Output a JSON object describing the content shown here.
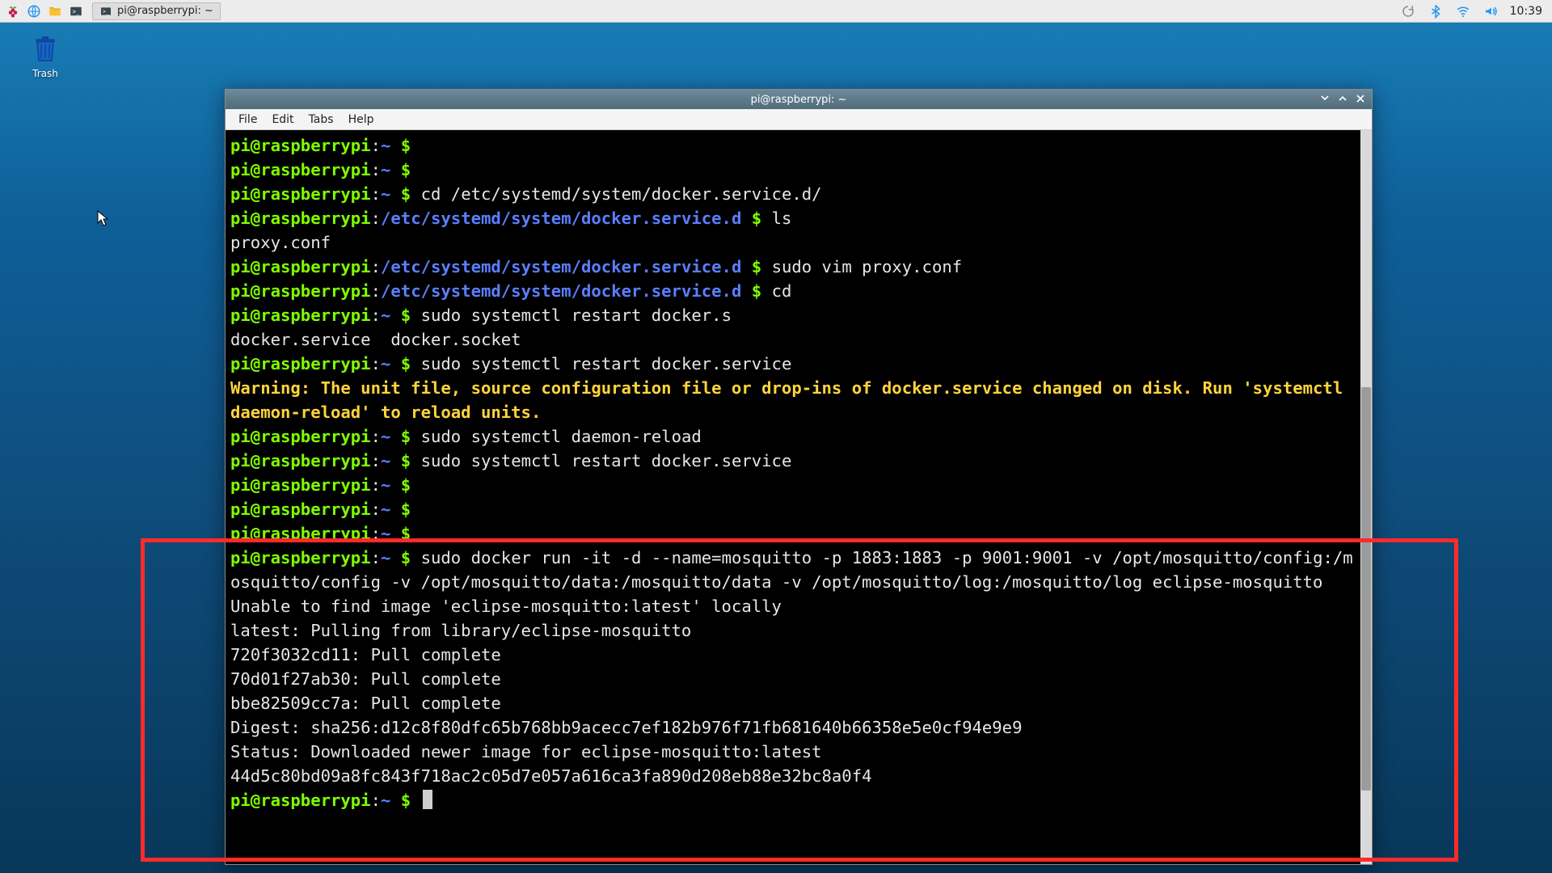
{
  "taskbar": {
    "task_label": "pi@raspberrypi: ~",
    "clock": "10:39"
  },
  "desktop": {
    "trash_label": "Trash"
  },
  "window": {
    "title": "pi@raspberrypi: ~",
    "menu": {
      "file": "File",
      "edit": "Edit",
      "tabs": "Tabs",
      "help": "Help"
    }
  },
  "term": {
    "prompt_user": "pi@raspberrypi",
    "path_home": "~",
    "path_docker": "/etc/systemd/system/docker.service.d",
    "dollar": " $ ",
    "lines": {
      "cd_docker": "cd /etc/systemd/system/docker.service.d/",
      "ls": "ls",
      "out_proxy": "proxy.conf",
      "vim": "sudo vim proxy.conf",
      "cd": "cd",
      "restart_partial": "sudo systemctl restart docker.s",
      "out_services": "docker.service  docker.socket",
      "restart_full": "sudo systemctl restart docker.service",
      "warning": "Warning: The unit file, source configuration file or drop-ins of docker.service changed on disk. Run 'systemctl daemon-reload' to reload units.",
      "daemon_reload": "sudo systemctl daemon-reload",
      "docker_run": "sudo docker run -it -d --name=mosquitto -p 1883:1883 -p 9001:9001 -v /opt/mosquitto/config:/mosquitto/config -v /opt/mosquitto/data:/mosquitto/data -v /opt/mosquitto/log:/mosquitto/log eclipse-mosquitto",
      "out_notfound": "Unable to find image 'eclipse-mosquitto:latest' locally",
      "out_pullfrom": "latest: Pulling from library/eclipse-mosquitto",
      "out_pull1": "720f3032cd11: Pull complete",
      "out_pull2": "70d01f27ab30: Pull complete",
      "out_pull3": "bbe82509cc7a: Pull complete",
      "out_digest": "Digest: sha256:d12c8f80dfc65b768bb9acecc7ef182b976f71fb681640b66358e5e0cf94e9e9",
      "out_status": "Status: Downloaded newer image for eclipse-mosquitto:latest",
      "out_hash": "44d5c80bd09a8fc843f718ac2c05d7e057a616ca3fa890d208eb88e32bc8a0f4"
    }
  }
}
